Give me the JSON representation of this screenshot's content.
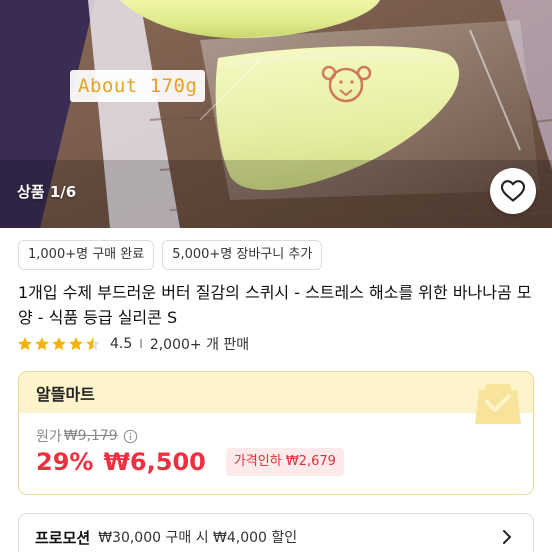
{
  "gallery": {
    "weight_label": "About 170g",
    "counter": "상품 1/6",
    "favorite_icon": "heart-outline-icon"
  },
  "badges": [
    "1,000+명 구매 완료",
    "5,000+명 장바구니 추가"
  ],
  "product": {
    "title": "1개입 수제 부드러운 버터 질감의 스퀴시 - 스트레스 해소를 위한 바나나곰 모양 - 식품 등급 실리콘 S"
  },
  "rating": {
    "value": "4.5",
    "stars": 4.5,
    "divider": "I",
    "count": "2,000+ 개 판매",
    "star_color": "#f5b301"
  },
  "price": {
    "store_name": "알뜰마트",
    "original_label": "원가",
    "original_price": "₩9,179",
    "info_icon": "info-circle-icon",
    "discount": "29%",
    "sale_price": "₩6,500",
    "price_cut": "가격인하 ₩2,679",
    "accent_color": "#f0303f"
  },
  "promotion": {
    "tag": "프로모션",
    "text": "₩30,000 구매 시 ₩4,000 할인",
    "chevron_icon": "chevron-right-icon"
  }
}
